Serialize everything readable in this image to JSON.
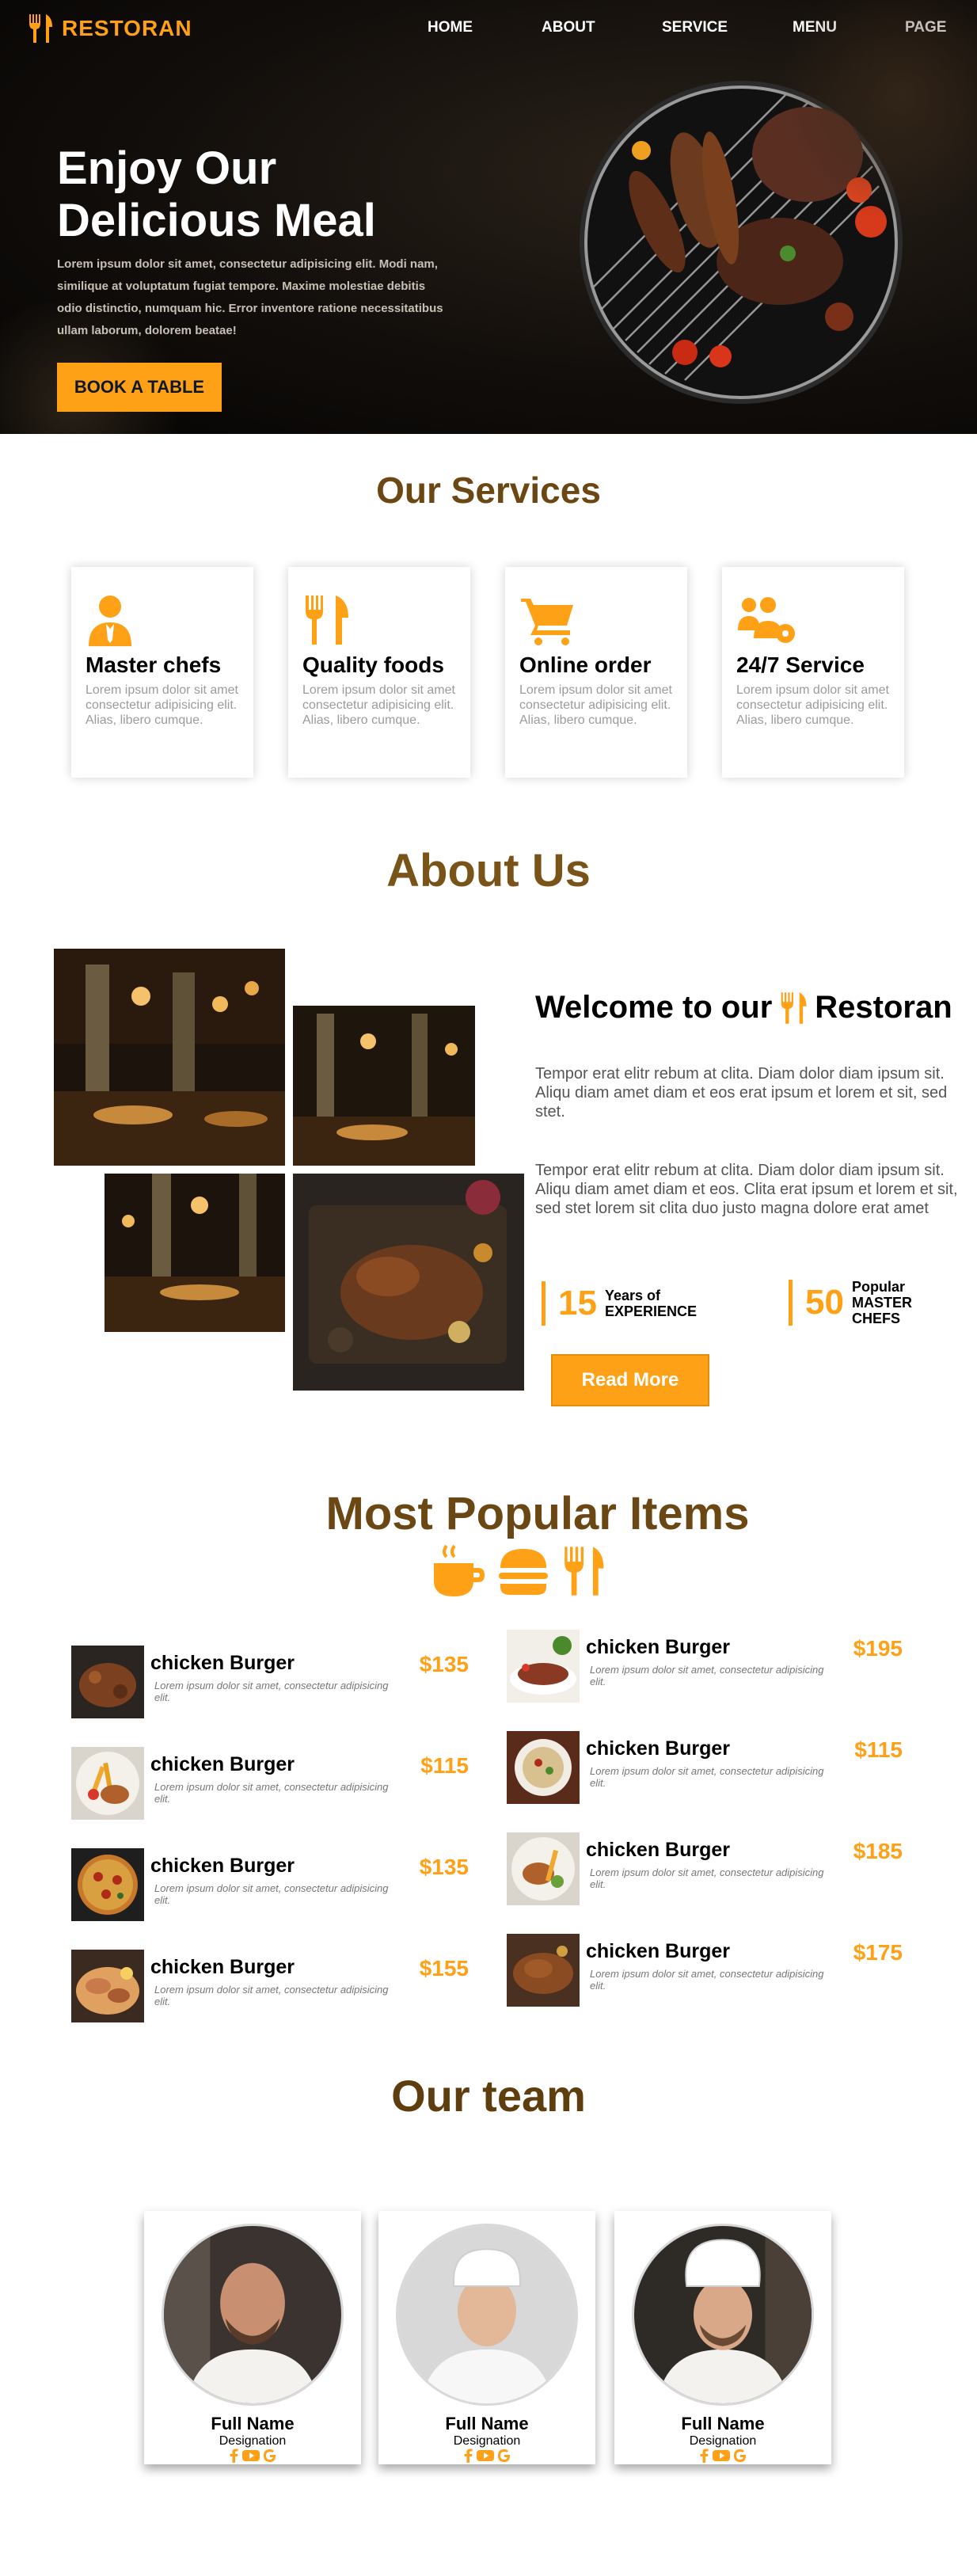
{
  "nav": {
    "brand": "RESTORAN",
    "links": [
      "HOME",
      "ABOUT",
      "SERVICE",
      "MENU",
      "PAGE"
    ]
  },
  "hero": {
    "title": "Enjoy Our Delicious Meal",
    "text": "Lorem ipsum dolor sit amet, consectetur adipisicing elit. Modi nam, similique at voluptatum fugiat tempore. Maxime molestiae debitis odio distinctio, numquam hic. Error inventore ratione necessitatibus ullam laborum, dolorem beatae!",
    "button": "BOOK A TABLE"
  },
  "services": {
    "title": "Our Services",
    "cards": [
      {
        "icon": "chef-icon",
        "title": "Master chefs",
        "text": "Lorem ipsum dolor sit amet consectetur adipisicing elit. Alias, libero cumque."
      },
      {
        "icon": "utensils-icon",
        "title": "Quality foods",
        "text": "Lorem ipsum dolor sit amet consectetur adipisicing elit. Alias, libero cumque."
      },
      {
        "icon": "cart-icon",
        "title": "Online order",
        "text": "Lorem ipsum dolor sit amet consectetur adipisicing elit. Alias, libero cumque."
      },
      {
        "icon": "users-gear-icon",
        "title": "24/7 Service",
        "text": "Lorem ipsum dolor sit amet consectetur adipisicing elit. Alias, libero cumque."
      }
    ]
  },
  "about": {
    "title": "About Us",
    "welcome_prefix": "Welcome to our",
    "welcome_suffix": "Restoran",
    "para1": "Tempor erat elitr rebum at clita. Diam dolor diam ipsum sit. Aliqu diam amet diam et eos erat ipsum et lorem et sit, sed stet.",
    "para2": "Tempor erat elitr rebum at clita. Diam dolor diam ipsum sit. Aliqu diam amet diam et eos. Clita erat ipsum et lorem et sit, sed stet lorem sit clita duo justo magna dolore erat amet",
    "stats": [
      {
        "num": "15",
        "line1": "Years of",
        "line2": "EXPERIENCE",
        "line3": ""
      },
      {
        "num": "50",
        "line1": "Popular",
        "line2": "MASTER",
        "line3": "CHEFS"
      }
    ],
    "button": "Read More"
  },
  "menu": {
    "title": "Most Popular Items",
    "left": [
      {
        "name": "chicken Burger",
        "desc": "Lorem ipsum dolor sit amet, consectetur adipisicing elit.",
        "price": "$135"
      },
      {
        "name": "chicken Burger",
        "desc": "Lorem ipsum dolor sit amet, consectetur adipisicing elit.",
        "price": "$115"
      },
      {
        "name": "chicken Burger",
        "desc": "Lorem ipsum dolor sit amet, consectetur adipisicing elit.",
        "price": "$135"
      },
      {
        "name": "chicken Burger",
        "desc": "Lorem ipsum dolor sit amet, consectetur adipisicing elit.",
        "price": "$155"
      }
    ],
    "right": [
      {
        "name": "chicken Burger",
        "desc": "Lorem ipsum dolor sit amet, consectetur adipisicing elit.",
        "price": "$195"
      },
      {
        "name": "chicken Burger",
        "desc": "Lorem ipsum dolor sit amet, consectetur adipisicing elit.",
        "price": "$115"
      },
      {
        "name": "chicken Burger",
        "desc": "Lorem ipsum dolor sit amet, consectetur adipisicing elit.",
        "price": "$185"
      },
      {
        "name": "chicken Burger",
        "desc": "Lorem ipsum dolor sit amet, consectetur adipisicing elit.",
        "price": "$175"
      }
    ]
  },
  "team": {
    "title": "Our team",
    "members": [
      {
        "name": "Full Name",
        "designation": "Designation"
      },
      {
        "name": "Full Name",
        "designation": "Designation"
      },
      {
        "name": "Full Name",
        "designation": "Designation"
      }
    ]
  },
  "colors": {
    "accent": "#fea116",
    "heading": "#6b4713",
    "hero_bg": "#0b0908"
  }
}
